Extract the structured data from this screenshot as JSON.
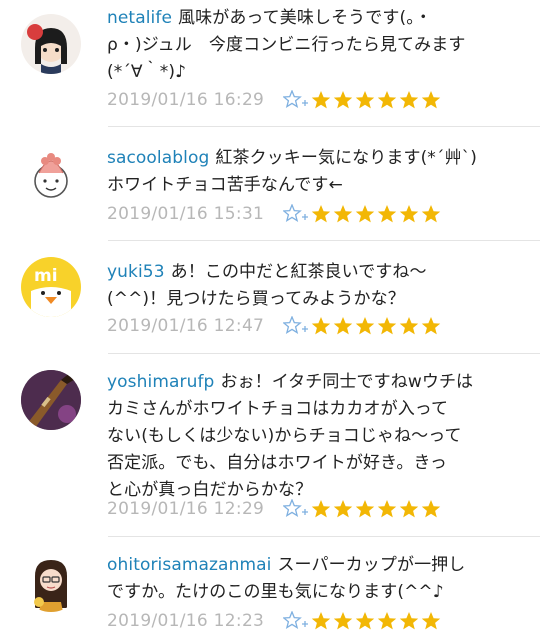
{
  "comments": [
    {
      "username": "netalife",
      "text": "風味があって美味しそうです(。・ρ・)ジュル　今度コンビニ行ったら見てみます(*´∀｀*)♪",
      "lines": [
        "風味があって美味しそうです(。・",
        "ρ・)ジュル　今度コンビニ行ったら見てみます",
        "(*´∀｀*)♪"
      ],
      "timestamp": "2019/01/16 16:29",
      "stars": 6
    },
    {
      "username": "sacoolablog",
      "text": "紅茶クッキー気になります(*´艸`)ホワイトチョコ苦手なんです←",
      "lines": [
        "紅茶クッキー気になります(*´艸`)",
        "ホワイトチョコ苦手なんです←"
      ],
      "timestamp": "2019/01/16 15:31",
      "stars": 6
    },
    {
      "username": "yuki53",
      "text": "あ！この中だと紅茶良いですね〜(^^)！見つけたら買ってみようかな？",
      "lines": [
        "あ！この中だと紅茶良いですね〜",
        "(^^)！見つけたら買ってみようかな？"
      ],
      "timestamp": "2019/01/16 12:47",
      "stars": 6
    },
    {
      "username": "yoshimarufp",
      "text": "おぉ！イタチ同士ですねwウチはカミさんがホワイトチョコはカカオが入ってない(もしくは少ない)からチョコじゃね〜って否定派。でも、自分はホワイトが好き。きっと心が真っ白だからかな？",
      "lines": [
        "おぉ！イタチ同士ですねwウチは",
        "カミさんがホワイトチョコはカカオが入って",
        "ない(もしくは少ない)からチョコじゃね〜って",
        "否定派。でも、自分はホワイトが好き。きっ",
        "と心が真っ白だからかな？"
      ],
      "timestamp": "2019/01/16 12:29",
      "stars": 6
    },
    {
      "username": "ohitorisamazanmai",
      "text": "スーパーカップが一押しですか。たけのこの里も気になります(^^♪",
      "lines": [
        "スーパーカップが一押し",
        "ですか。たけのこの里も気になります(^^♪"
      ],
      "timestamp": "2019/01/16 12:23",
      "stars": 6
    }
  ],
  "colors": {
    "username": "#1f82b8",
    "timestamp": "#b7b7b7",
    "star": "#f2b705",
    "like_icon": "#7fb0e0",
    "separator": "#e4e4e4"
  },
  "icons": {
    "like": "star-plus-icon",
    "rating": "star-icon"
  }
}
